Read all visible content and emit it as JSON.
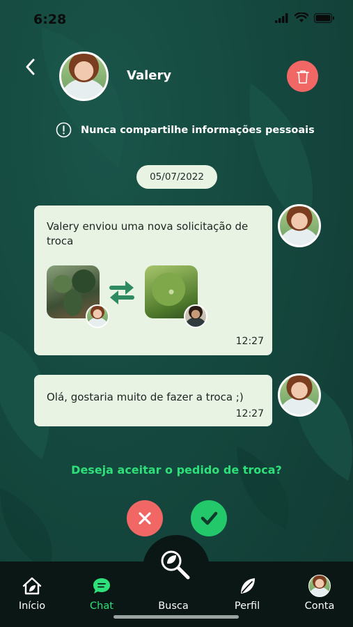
{
  "status": {
    "time": "6:28"
  },
  "header": {
    "contact_name": "Valery"
  },
  "warning": {
    "text": "Nunca compartilhe informações pessoais"
  },
  "chat": {
    "date": "05/07/2022",
    "messages": [
      {
        "text": "Valery enviou uma nova solicitação de troca",
        "time": "12:27"
      },
      {
        "text": "Olá, gostaria muito de fazer a troca ;)",
        "time": "12:27"
      }
    ]
  },
  "prompt": {
    "question": "Deseja aceitar o pedido de troca?"
  },
  "tabs": [
    {
      "label": "Início",
      "icon": "home-icon"
    },
    {
      "label": "Chat",
      "icon": "chat-icon"
    },
    {
      "label": "Busca",
      "icon": "search-leaf-icon"
    },
    {
      "label": "Perfil",
      "icon": "leaf-icon"
    },
    {
      "label": "Conta",
      "icon": "avatar-icon"
    }
  ],
  "colors": {
    "background": "#154a40",
    "bubble": "#e9f3e3",
    "accent": "#2ee07a",
    "danger": "#f06766",
    "success": "#22c86a",
    "tabbar": "#0a1714"
  }
}
